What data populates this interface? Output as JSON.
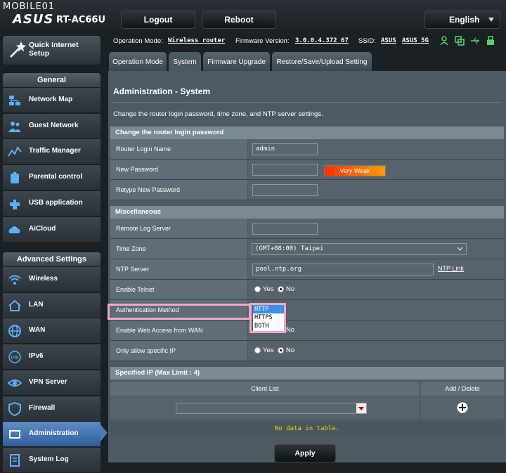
{
  "watermark": "MOBILE01",
  "brand": {
    "logo": "ASUS",
    "model": "RT-AC66U"
  },
  "top": {
    "logout": "Logout",
    "reboot": "Reboot",
    "language": "English"
  },
  "status": {
    "op_mode_label": "Operation Mode:",
    "op_mode": "Wireless router",
    "fw_label": "Firmware Version:",
    "fw": "3.0.0.4.372_67",
    "ssid_label": "SSID:",
    "ssid1": "ASUS",
    "ssid2": "ASUS_5G"
  },
  "sidebar": {
    "qis": "Quick Internet Setup",
    "general_header": "General",
    "general": [
      "Network Map",
      "Guest Network",
      "Traffic Manager",
      "Parental control",
      "USB application",
      "AiCloud"
    ],
    "advanced_header": "Advanced Settings",
    "advanced": [
      "Wireless",
      "LAN",
      "WAN",
      "IPv6",
      "VPN Server",
      "Firewall",
      "Administration",
      "System Log"
    ]
  },
  "tabs": [
    "Operation Mode",
    "System",
    "Firmware Upgrade",
    "Restore/Save/Upload Setting"
  ],
  "page": {
    "title": "Administration - System",
    "desc": "Change the router login password, time zone, and NTP server settings."
  },
  "login": {
    "header": "Change the router login password",
    "name_label": "Router Login Name",
    "name_value": "admin",
    "pw_label": "New Password",
    "strength": "Very Weak",
    "retype_label": "Retype New Password"
  },
  "misc": {
    "header": "Miscellaneous",
    "remote_log": "Remote Log Server",
    "timezone_label": "Time Zone",
    "timezone": "(GMT+08:00) Taipei",
    "ntp_label": "NTP Server",
    "ntp_value": "pool.ntp.org",
    "ntp_link": "NTP Link",
    "telnet_label": "Enable Telnet",
    "auth_label": "Authentication Method",
    "auth_options": [
      "HTTP",
      "HTTPS",
      "BOTH"
    ],
    "webwan_label": "Enable Web Access from WAN",
    "specific_ip_label": "Only allow specific IP",
    "yes": "Yes",
    "no": "No"
  },
  "specified": {
    "header": "Specified IP (Max Limit : 4)",
    "col_client": "Client List",
    "col_add": "Add / Delete",
    "nodata": "No data in table."
  },
  "apply": "Apply",
  "colors": {
    "accent": "#4c7bb5",
    "strength_from": "#ff3000",
    "strength_to": "#ff9a00",
    "highlight": "#f3a6c8",
    "nodata": "#ffcc00"
  }
}
